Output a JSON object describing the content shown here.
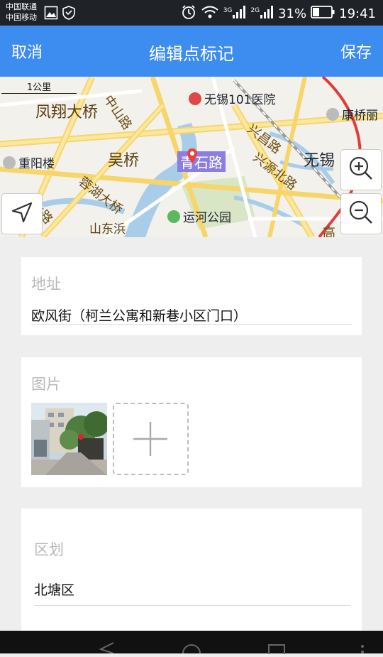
{
  "status_bar": {
    "carrier_1": "中国联通",
    "carrier_2": "中国移动",
    "network_1": "3G",
    "network_2": "2G",
    "battery": "31%",
    "time": "19:41"
  },
  "header": {
    "cancel_label": "取消",
    "title": "编辑点标记",
    "save_label": "保存"
  },
  "map": {
    "scale": "1公里",
    "labels": {
      "fengxiang": "凤翔大桥",
      "zhongshan": "中山路",
      "hospital": "无锡101医院",
      "xingchang": "兴昌路",
      "kangqiao": "康桥丽",
      "chongyang": "重阳楼",
      "wuqiao": "吴桥",
      "qingshi": "青石路",
      "xingyuan": "兴源北路",
      "wuxi": "无锡",
      "liuhu": "蓉湖大桥",
      "shanlu": "山路",
      "shandongbin": "山东浜",
      "yunhe": "运河公园",
      "gao": "高"
    },
    "icons": [
      "zoom-in-icon",
      "zoom-out-icon",
      "locate-icon",
      "map-pin-icon"
    ]
  },
  "address": {
    "label": "地址",
    "value": "欧风街（柯兰公寓和新巷小区门口）"
  },
  "pictures": {
    "label": "图片"
  },
  "district": {
    "label": "区划",
    "value": "北塘区"
  },
  "colors": {
    "header": "#3d8cf0",
    "status_bar": "#1f2328",
    "background": "#eeeeee"
  }
}
